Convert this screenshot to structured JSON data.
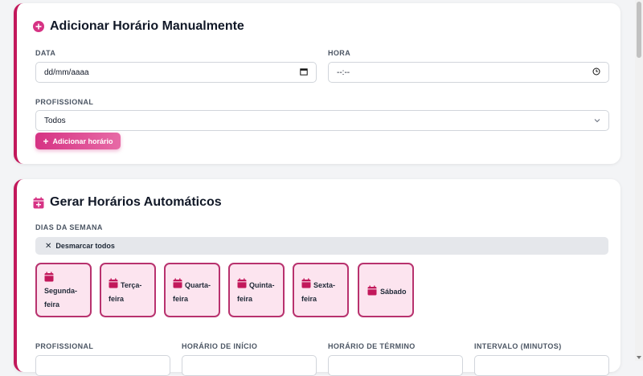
{
  "manual": {
    "title": "Adicionar Horário Manualmente",
    "date_label": "DATA",
    "date_placeholder": "dd/mm/aaaa",
    "time_label": "HORA",
    "time_placeholder": "--:--",
    "professional_label": "PROFISSIONAL",
    "professional_value": "Todos",
    "add_button": "Adicionar horário"
  },
  "auto": {
    "title": "Gerar Horários Automáticos",
    "weekdays_label": "DIAS DA SEMANA",
    "toggle_all": "Desmarcar todos",
    "days": [
      {
        "line1": "Segunda-",
        "line2": "feira"
      },
      {
        "line1": "Terça-",
        "line2": "feira"
      },
      {
        "line1": "Quarta-",
        "line2": "feira"
      },
      {
        "line1": "Quinta-",
        "line2": "feira"
      },
      {
        "line1": "Sexta-",
        "line2": "feira"
      },
      {
        "line1": "Sábado",
        "line2": ""
      }
    ],
    "professional_label": "PROFISSIONAL",
    "start_label": "HORÁRIO DE INÍCIO",
    "end_label": "HORÁRIO DE TÉRMINO",
    "interval_label": "INTERVALO (MINUTOS)"
  },
  "colors": {
    "accent": "#c2185b",
    "day_bg": "#fce4ef",
    "button_gradient_start": "#d63384"
  }
}
